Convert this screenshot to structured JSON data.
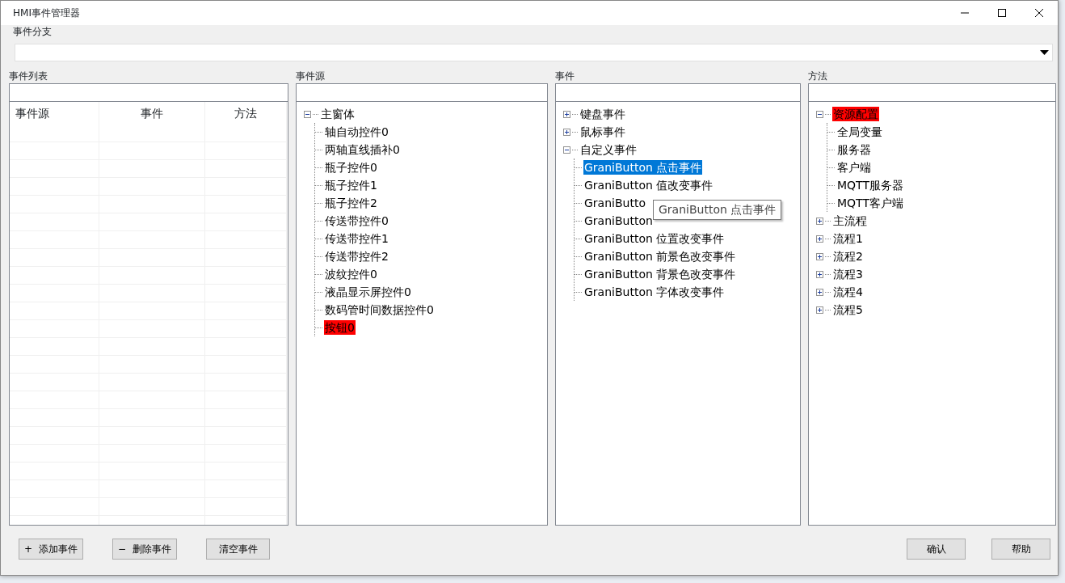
{
  "window": {
    "title": "HMI事件管理器"
  },
  "branch": {
    "label": "事件分支"
  },
  "event_list": {
    "label": "事件列表",
    "columns": [
      "事件源",
      "事件",
      "方法"
    ]
  },
  "source": {
    "label": "事件源",
    "tree": [
      {
        "label": "主窗体",
        "expanded": true,
        "selected": false,
        "marked": false,
        "children": [
          {
            "label": "轴自动控件0",
            "selected": false,
            "marked": false
          },
          {
            "label": "两轴直线插补0",
            "selected": false,
            "marked": false
          },
          {
            "label": "瓶子控件0",
            "selected": false,
            "marked": false
          },
          {
            "label": "瓶子控件1",
            "selected": false,
            "marked": false
          },
          {
            "label": "瓶子控件2",
            "selected": false,
            "marked": false
          },
          {
            "label": "传送带控件0",
            "selected": false,
            "marked": false
          },
          {
            "label": "传送带控件1",
            "selected": false,
            "marked": false
          },
          {
            "label": "传送带控件2",
            "selected": false,
            "marked": false
          },
          {
            "label": "波纹控件0",
            "selected": false,
            "marked": false
          },
          {
            "label": "液晶显示屏控件0",
            "selected": false,
            "marked": false
          },
          {
            "label": "数码管时间数据控件0",
            "selected": false,
            "marked": false
          },
          {
            "label": "按钮0",
            "selected": false,
            "marked": true
          }
        ]
      }
    ]
  },
  "events": {
    "label": "事件",
    "tree": [
      {
        "label": "键盘事件",
        "expanded": false,
        "selected": false,
        "marked": false
      },
      {
        "label": "鼠标事件",
        "expanded": false,
        "selected": false,
        "marked": false
      },
      {
        "label": "自定义事件",
        "expanded": true,
        "selected": false,
        "marked": false,
        "children": [
          {
            "label": "GraniButton 点击事件",
            "selected": true,
            "marked": false
          },
          {
            "label": "GraniButton 值改变事件",
            "selected": false,
            "marked": false
          },
          {
            "label": "GraniButto",
            "selected": false,
            "marked": false
          },
          {
            "label": "GraniButton",
            "selected": false,
            "marked": false
          },
          {
            "label": "GraniButton 位置改变事件",
            "selected": false,
            "marked": false
          },
          {
            "label": "GraniButton 前景色改变事件",
            "selected": false,
            "marked": false
          },
          {
            "label": "GraniButton 背景色改变事件",
            "selected": false,
            "marked": false
          },
          {
            "label": "GraniButton 字体改变事件",
            "selected": false,
            "marked": false
          }
        ]
      }
    ],
    "tooltip": "GraniButton 点击事件"
  },
  "methods": {
    "label": "方法",
    "tree": [
      {
        "label": "资源配置",
        "expanded": true,
        "selected": false,
        "marked": true,
        "children": [
          {
            "label": "全局变量",
            "selected": false,
            "marked": false
          },
          {
            "label": "服务器",
            "selected": false,
            "marked": false
          },
          {
            "label": "客户端",
            "selected": false,
            "marked": false
          },
          {
            "label": "MQTT服务器",
            "selected": false,
            "marked": false
          },
          {
            "label": "MQTT客户端",
            "selected": false,
            "marked": false
          }
        ]
      },
      {
        "label": "主流程",
        "expanded": false,
        "selected": false,
        "marked": false
      },
      {
        "label": "流程1",
        "expanded": false,
        "selected": false,
        "marked": false
      },
      {
        "label": "流程2",
        "expanded": false,
        "selected": false,
        "marked": false
      },
      {
        "label": "流程3",
        "expanded": false,
        "selected": false,
        "marked": false
      },
      {
        "label": "流程4",
        "expanded": false,
        "selected": false,
        "marked": false
      },
      {
        "label": "流程5",
        "expanded": false,
        "selected": false,
        "marked": false
      }
    ]
  },
  "buttons_left": [
    {
      "icon": "+",
      "label": "添加事件"
    },
    {
      "icon": "−",
      "label": "删除事件"
    },
    {
      "label": "清空事件"
    }
  ],
  "buttons_right": [
    {
      "label": "确认"
    },
    {
      "label": "帮助"
    }
  ]
}
